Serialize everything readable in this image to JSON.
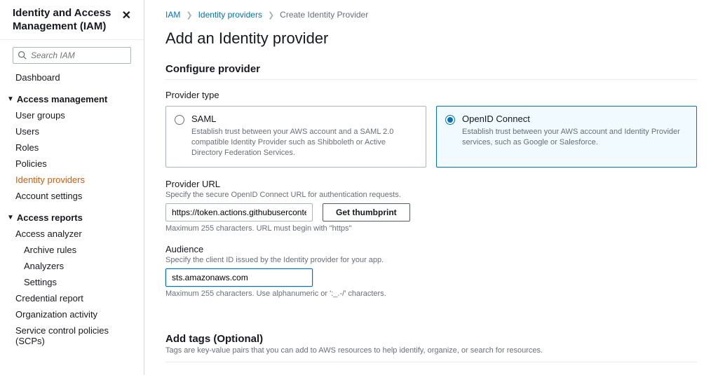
{
  "sidebar": {
    "title": "Identity and Access Management (IAM)",
    "search_placeholder": "Search IAM",
    "dashboard": "Dashboard",
    "groups": {
      "access_mgmt": {
        "label": "Access management",
        "items": [
          "User groups",
          "Users",
          "Roles",
          "Policies",
          "Identity providers",
          "Account settings"
        ],
        "active_index": 4
      },
      "access_reports": {
        "label": "Access reports",
        "items": [
          "Access analyzer"
        ],
        "sub": [
          "Archive rules",
          "Analyzers",
          "Settings"
        ],
        "tail": [
          "Credential report",
          "Organization activity",
          "Service control policies (SCPs)"
        ]
      }
    }
  },
  "breadcrumb": {
    "items": [
      "IAM",
      "Identity providers",
      "Create Identity Provider"
    ]
  },
  "page": {
    "title": "Add an Identity provider",
    "configure_title": "Configure provider",
    "provider_type_label": "Provider type",
    "providers": {
      "saml": {
        "name": "SAML",
        "desc": "Establish trust between your AWS account and a SAML 2.0 compatible Identity Provider such as Shibboleth or Active Directory Federation Services."
      },
      "oidc": {
        "name": "OpenID Connect",
        "desc": "Establish trust between your AWS account and Identity Provider services, such as Google or Salesforce."
      }
    },
    "provider_url": {
      "label": "Provider URL",
      "help": "Specify the secure OpenID Connect URL for authentication requests.",
      "value": "https://token.actions.githubusercontent.co",
      "button": "Get thumbprint",
      "hint": "Maximum 255 characters. URL must begin with \"https\""
    },
    "audience": {
      "label": "Audience",
      "help": "Specify the client ID issued by the Identity provider for your app.",
      "value": "sts.amazonaws.com",
      "hint": "Maximum 255 characters. Use alphanumeric or ':_.-/' characters."
    },
    "tags": {
      "title": "Add tags (Optional)",
      "desc": "Tags are key-value pairs that you can add to AWS resources to help identify, organize, or search for resources."
    }
  }
}
